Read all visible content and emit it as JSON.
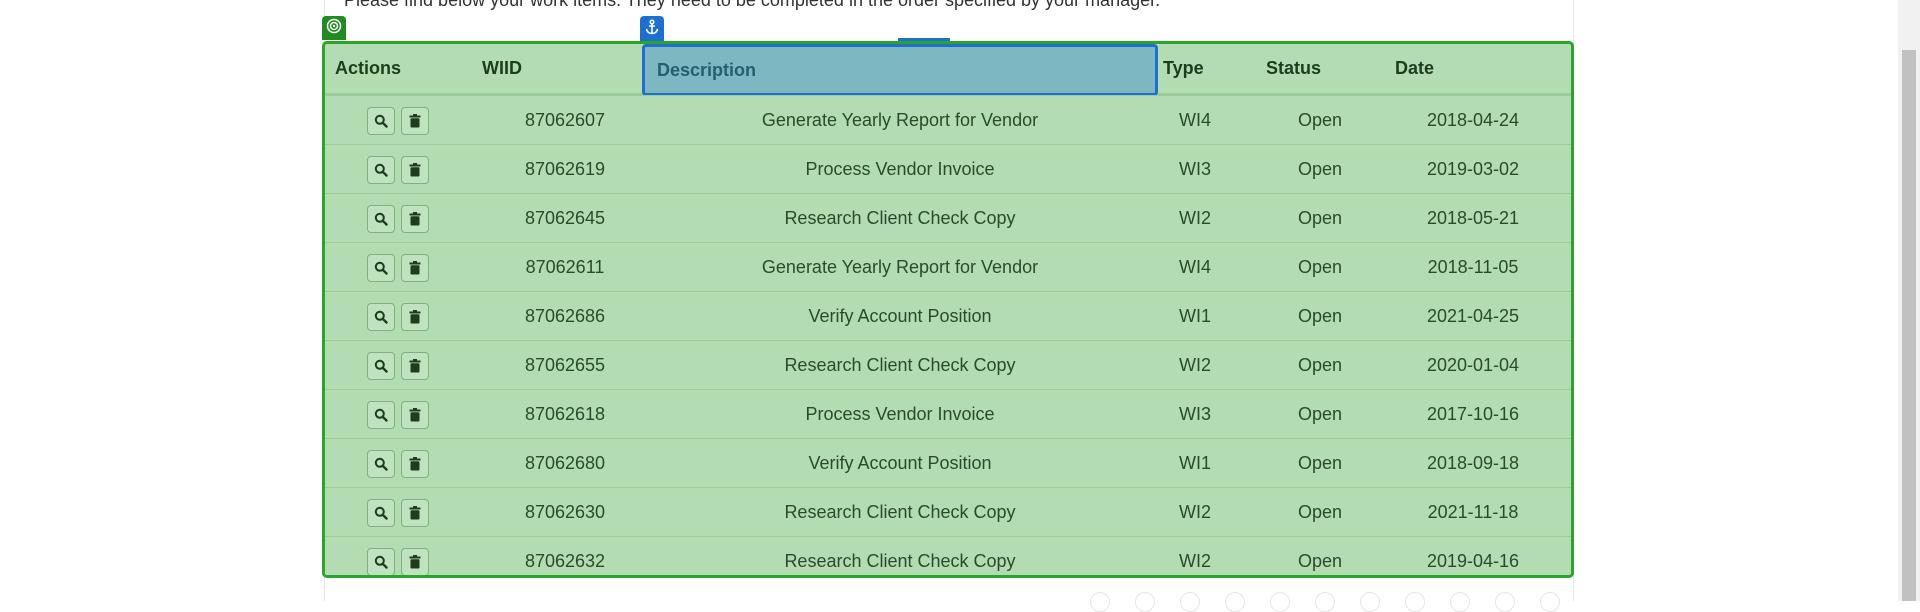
{
  "intro_text": "Please find below your work items. They need to be completed in the order specified by your manager.",
  "table": {
    "headers": {
      "actions": "Actions",
      "wiid": "WIID",
      "description": "Description",
      "type": "Type",
      "status": "Status",
      "date": "Date"
    },
    "rows": [
      {
        "wiid": "87062607",
        "description": "Generate Yearly Report for Vendor",
        "type": "WI4",
        "status": "Open",
        "date": "2018-04-24"
      },
      {
        "wiid": "87062619",
        "description": "Process Vendor Invoice",
        "type": "WI3",
        "status": "Open",
        "date": "2019-03-02"
      },
      {
        "wiid": "87062645",
        "description": "Research Client Check Copy",
        "type": "WI2",
        "status": "Open",
        "date": "2018-05-21"
      },
      {
        "wiid": "87062611",
        "description": "Generate Yearly Report for Vendor",
        "type": "WI4",
        "status": "Open",
        "date": "2018-11-05"
      },
      {
        "wiid": "87062686",
        "description": "Verify Account Position",
        "type": "WI1",
        "status": "Open",
        "date": "2021-04-25"
      },
      {
        "wiid": "87062655",
        "description": "Research Client Check Copy",
        "type": "WI2",
        "status": "Open",
        "date": "2020-01-04"
      },
      {
        "wiid": "87062618",
        "description": "Process Vendor Invoice",
        "type": "WI3",
        "status": "Open",
        "date": "2017-10-16"
      },
      {
        "wiid": "87062680",
        "description": "Verify Account Position",
        "type": "WI1",
        "status": "Open",
        "date": "2018-09-18"
      },
      {
        "wiid": "87062630",
        "description": "Research Client Check Copy",
        "type": "WI2",
        "status": "Open",
        "date": "2021-11-18"
      },
      {
        "wiid": "87062632",
        "description": "Research Client Check Copy",
        "type": "WI2",
        "status": "Open",
        "date": "2019-04-16"
      }
    ]
  },
  "icons": {
    "view": "search-icon",
    "delete": "trash-icon",
    "target": "target-icon",
    "anchor": "anchor-icon"
  },
  "colors": {
    "table_bg": "#b3dcb3",
    "table_border": "#2aa52a",
    "highlight_bg": "#7db7c2",
    "highlight_border": "#1f6fd1"
  }
}
